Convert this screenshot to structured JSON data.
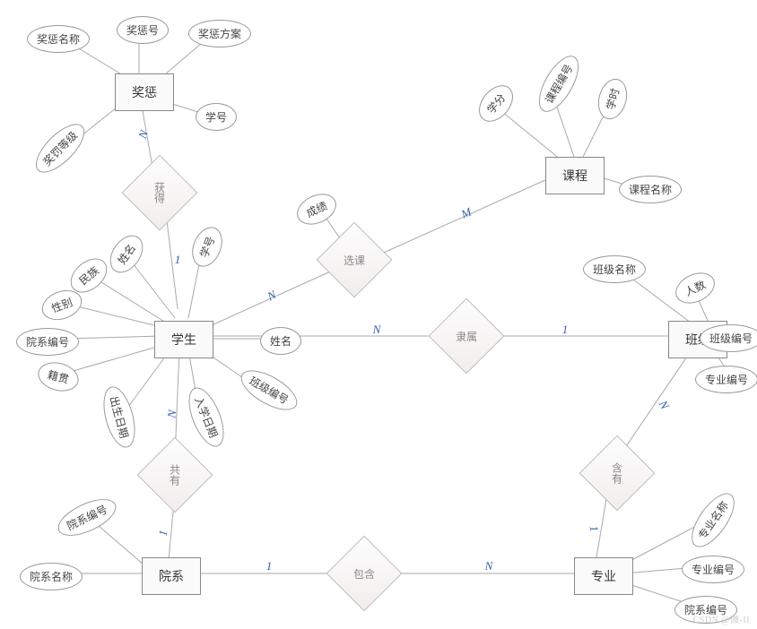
{
  "entities": {
    "reward": {
      "label": "奖惩",
      "attrs": [
        "奖惩名称",
        "奖惩号",
        "奖惩方案",
        "学号",
        "奖罚等级"
      ]
    },
    "course": {
      "label": "课程",
      "attrs": [
        "学分",
        "课程编号",
        "学时",
        "课程名称"
      ]
    },
    "student": {
      "label": "学生",
      "attrs": [
        "姓名",
        "民族",
        "性别",
        "院系编号",
        "籍贯",
        "出生日期",
        "学号",
        "入学日期",
        "班级编号",
        "姓名"
      ]
    },
    "classE": {
      "label": "班级",
      "attrs": [
        "班级名称",
        "人数",
        "班级编号",
        "专业编号"
      ]
    },
    "dept": {
      "label": "院系",
      "attrs": [
        "院系编号",
        "院系名称"
      ]
    },
    "major": {
      "label": "专业",
      "attrs": [
        "专业名称",
        "专业编号",
        "院系编号"
      ]
    }
  },
  "relationships": {
    "gain": {
      "label": "获得",
      "cards": [
        "N",
        "1"
      ]
    },
    "select": {
      "label": "选课",
      "cards": [
        "N",
        "M"
      ],
      "attr": "成绩"
    },
    "belong": {
      "label": "隶属",
      "cards": [
        "N",
        "1"
      ]
    },
    "have": {
      "label": "共有",
      "cards": [
        "N",
        "1"
      ]
    },
    "inc1": {
      "label": "含有",
      "cards": [
        "N",
        "1"
      ]
    },
    "inc2": {
      "label": "包含",
      "cards": [
        "1",
        "N"
      ]
    }
  },
  "watermark": "CSDN @微-II"
}
